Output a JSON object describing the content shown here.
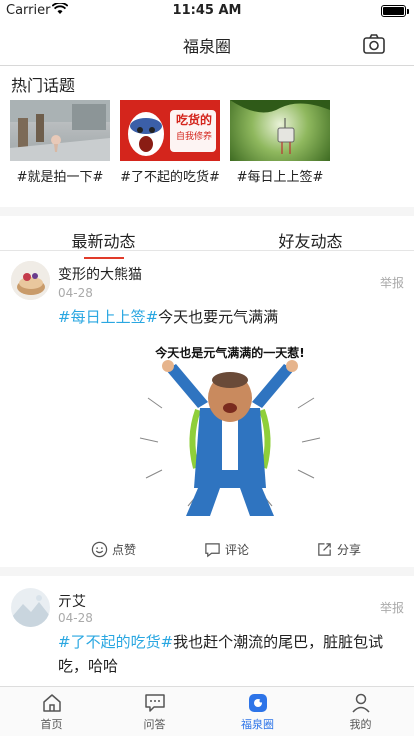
{
  "status_bar": {
    "carrier": "Carrier",
    "time": "11:45 AM"
  },
  "nav": {
    "title": "福泉圈",
    "camera_icon": "camera-icon"
  },
  "hot_topics": {
    "title": "热门话题",
    "items": [
      {
        "label": "#就是拍一下#"
      },
      {
        "label": "#了不起的吃货#",
        "thumb_text_1": "吃货的",
        "thumb_text_2": "自我修养"
      },
      {
        "label": "#每日上上签#"
      }
    ]
  },
  "tabs": {
    "latest": "最新动态",
    "friends": "好友动态"
  },
  "posts": [
    {
      "username": "变形的大熊猫",
      "date": "04-28",
      "report": "举报",
      "hashtag": "#每日上上签#",
      "text": "今天也要元气满满",
      "image_caption": "今天也是元气满满的一天惹!"
    },
    {
      "username": "亓艾",
      "date": "04-28",
      "report": "举报",
      "hashtag": "#了不起的吃货#",
      "text": "我也赶个潮流的尾巴，脏脏包试吃，哈哈"
    }
  ],
  "actions": {
    "like": "点赞",
    "comment": "评论",
    "share": "分享"
  },
  "tab_bar": [
    {
      "label": "首页",
      "icon": "home-icon"
    },
    {
      "label": "问答",
      "icon": "qa-icon"
    },
    {
      "label": "福泉圈",
      "icon": "circle-icon"
    },
    {
      "label": "我的",
      "icon": "profile-icon"
    }
  ],
  "colors": {
    "accent_red": "#e13b2a",
    "hashtag_blue": "#2aa7e1",
    "active_tab_blue": "#2d74e8"
  }
}
